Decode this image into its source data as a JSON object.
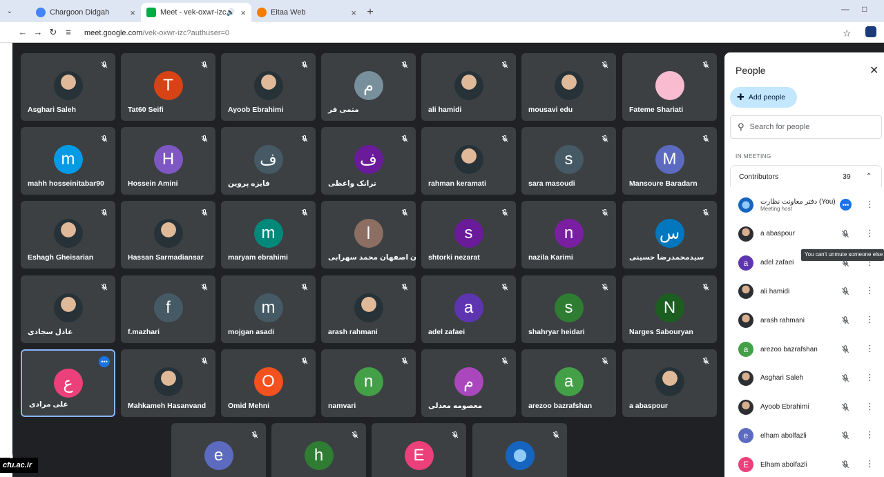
{
  "browser": {
    "tabs": [
      {
        "title": "Chargoon Didgah",
        "color": "#4285f4"
      },
      {
        "title": "Meet - vek-oxwr-izc",
        "color": "#00ac47"
      },
      {
        "title": "Eitaa Web",
        "color": "#f57c00"
      }
    ],
    "url_host": "meet.google.com",
    "url_path": "/vek-oxwr-izc?authuser=0"
  },
  "tiles": [
    {
      "name": "Asghari Saleh",
      "initial": "",
      "color": "",
      "photo": true
    },
    {
      "name": "Tat60 Seifi",
      "initial": "T",
      "color": "#d84315"
    },
    {
      "name": "Ayoob Ebrahimi",
      "initial": "",
      "color": "",
      "photo": true
    },
    {
      "name": "متمی فر",
      "initial": "م",
      "color": "#78909c"
    },
    {
      "name": "ali hamidi",
      "initial": "",
      "color": "",
      "photo": true
    },
    {
      "name": "mousavi edu",
      "initial": "",
      "color": "",
      "photo": true
    },
    {
      "name": "Fateme Shariati",
      "initial": "",
      "color": "#f8bbd0"
    },
    {
      "name": "mahh hosseinitabar90",
      "initial": "m",
      "color": "#039be5"
    },
    {
      "name": "Hossein Amini",
      "initial": "H",
      "color": "#7e57c2"
    },
    {
      "name": "فایزه پروین",
      "initial": "ف",
      "color": "#455a64"
    },
    {
      "name": "ترانک واعظی",
      "initial": "ف",
      "color": "#6a1b9a"
    },
    {
      "name": "rahman keramati",
      "initial": "",
      "color": "",
      "photo": true
    },
    {
      "name": "sara masoudi",
      "initial": "s",
      "color": "#455a64"
    },
    {
      "name": "Mansoure Baradarn",
      "initial": "M",
      "color": "#5c6bc0"
    },
    {
      "name": "Eshagh Gheisarian",
      "initial": "",
      "color": "",
      "photo": true
    },
    {
      "name": "Hassan Sarmadiansar",
      "initial": "",
      "color": "",
      "photo": true
    },
    {
      "name": "maryam ebrahimi",
      "initial": "m",
      "color": "#00897b"
    },
    {
      "name": "استان اصفهان محمد سهرابی",
      "initial": "ا",
      "color": "#8d6e63"
    },
    {
      "name": "shtorki nezarat",
      "initial": "s",
      "color": "#6a1b9a"
    },
    {
      "name": "nazila Karimi",
      "initial": "n",
      "color": "#7b1fa2"
    },
    {
      "name": "سیدمحمدرضا حسینی",
      "initial": "س",
      "color": "#0277bd"
    },
    {
      "name": "عادل سجادی",
      "initial": "",
      "color": "",
      "photo": true
    },
    {
      "name": "f.mazhari",
      "initial": "f",
      "color": "#455a64"
    },
    {
      "name": "mojgan asadi",
      "initial": "m",
      "color": "#455a64"
    },
    {
      "name": "arash rahmani",
      "initial": "",
      "color": "",
      "photo": true
    },
    {
      "name": "adel zafaei",
      "initial": "a",
      "color": "#5e35b1"
    },
    {
      "name": "shahryar heidari",
      "initial": "s",
      "color": "#2e7d32"
    },
    {
      "name": "Narges Sabouryan",
      "initial": "N",
      "color": "#1b5e20"
    },
    {
      "name": "علی مرادی",
      "initial": "ع",
      "color": "#ec407a",
      "pinned": true
    },
    {
      "name": "Mahkameh Hasanvand",
      "initial": "",
      "color": "",
      "photo": true
    },
    {
      "name": "Omid Mehni",
      "initial": "O",
      "color": "#f4511e"
    },
    {
      "name": "namvari",
      "initial": "n",
      "color": "#43a047"
    },
    {
      "name": "معصومه معدلی",
      "initial": "م",
      "color": "#ab47bc"
    },
    {
      "name": "arezoo bazrafshan",
      "initial": "a",
      "color": "#43a047"
    },
    {
      "name": "a abaspour",
      "initial": "",
      "color": "",
      "photo": true
    },
    {
      "name": "",
      "initial": "e",
      "color": "#5c6bc0"
    },
    {
      "name": "",
      "initial": "h",
      "color": "#2e7d32"
    },
    {
      "name": "",
      "initial": "E",
      "color": "#ec407a"
    },
    {
      "name": "",
      "initial": "",
      "color": "#1565c0",
      "photo": true
    }
  ],
  "watermark": {
    "label": "cfu.ac.ir",
    "count": "8"
  },
  "panel": {
    "title": "People",
    "add_label": "Add people",
    "search_placeholder": "Search for people",
    "section": "IN MEETING",
    "group": "Contributors",
    "count": "39",
    "tooltip": "You can't unmute someone else",
    "participants": [
      {
        "name": "دفتر معاونت نظارت (You)",
        "sub": "Meeting host",
        "initial": "",
        "color": "#1565c0",
        "photo": true,
        "host": true
      },
      {
        "name": "a abaspour",
        "initial": "",
        "color": "",
        "photo": true
      },
      {
        "name": "adel zafaei",
        "initial": "a",
        "color": "#5e35b1"
      },
      {
        "name": "ali hamidi",
        "initial": "",
        "color": "",
        "photo": true
      },
      {
        "name": "arash rahmani",
        "initial": "",
        "color": "",
        "photo": true
      },
      {
        "name": "arezoo bazrafshan",
        "initial": "a",
        "color": "#43a047"
      },
      {
        "name": "Asghari Saleh",
        "initial": "",
        "color": "",
        "photo": true
      },
      {
        "name": "Ayoob Ebrahimi",
        "initial": "",
        "color": "",
        "photo": true
      },
      {
        "name": "elham abolfazli",
        "initial": "e",
        "color": "#5c6bc0"
      },
      {
        "name": "Elham abolfazli",
        "initial": "E",
        "color": "#ec407a"
      }
    ]
  }
}
